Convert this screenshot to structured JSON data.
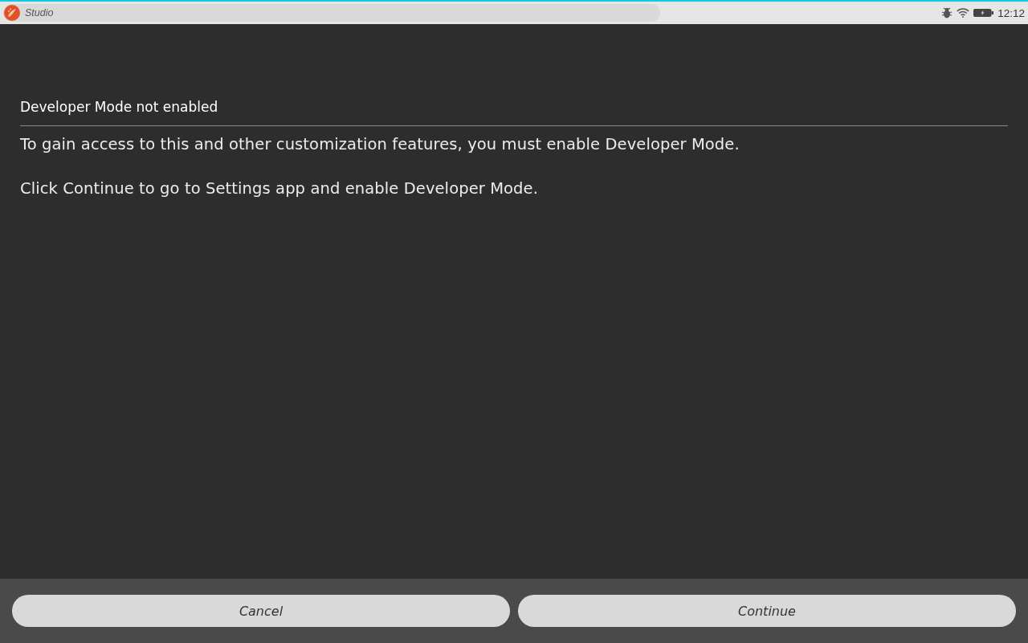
{
  "status_bar": {
    "app_title": "Studio",
    "time": "12:12"
  },
  "dialog": {
    "title": "Developer Mode not enabled",
    "paragraphs": [
      "To gain access to this and other customization features, you must enable Developer Mode.",
      "Click Continue to go to Settings app and enable Developer Mode."
    ]
  },
  "buttons": [
    {
      "label": "Cancel"
    },
    {
      "label": "Continue"
    }
  ]
}
